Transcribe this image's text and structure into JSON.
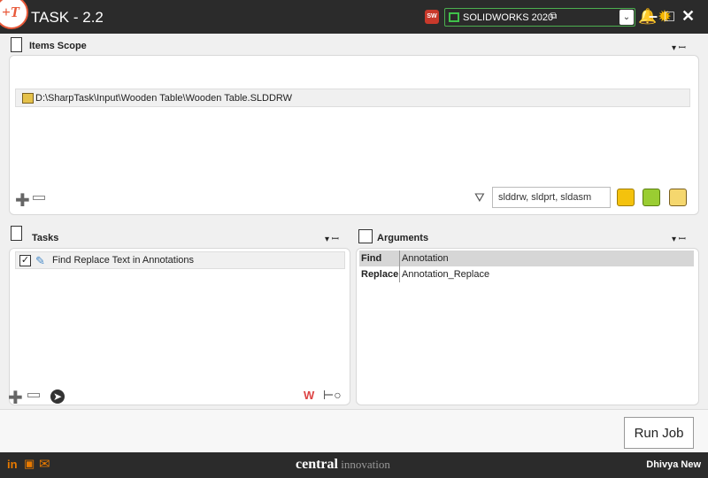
{
  "window": {
    "logo_text": "+T",
    "title": "TASK - 2.2",
    "solidworks_badge": "SW",
    "solidworks_version": "SOLIDWORKS 2020",
    "select_extra_glyph": "⧉",
    "dropdown_glyph": "⌄",
    "bell_glyph": "🔔",
    "gear_glyph": "✹",
    "minimize_glyph": "–",
    "maximize_glyph": "□",
    "close_glyph": "✕"
  },
  "items_scope": {
    "title": "Items Scope",
    "pin_glyph": "▾  ꟷ",
    "files": [
      "D:\\SharpTask\\Input\\Wooden Table\\Wooden Table.SLDDRW"
    ],
    "add_glyph": "✚",
    "filter_glyph": "⛛",
    "filter_value": "slddrw, sldprt, sldasm"
  },
  "tasks": {
    "title": "Tasks",
    "pin_glyph": "▾  ꟷ",
    "items": [
      {
        "label": "Find Replace Text in Annotations",
        "checked": "✓",
        "icon_glyph": "✎"
      }
    ],
    "globe_glyph": "➤",
    "w_glyph": "W",
    "key_glyph": "⊢○"
  },
  "arguments": {
    "title": "Arguments",
    "pin_glyph": "▾  ꟷ",
    "rows": [
      {
        "key": "Find",
        "value": "Annotation"
      },
      {
        "key": "Replace",
        "value": "Annotation_Replace"
      }
    ]
  },
  "actions": {
    "run_job_label": "Run Job"
  },
  "footer": {
    "linkedin": "in",
    "youtube_glyph": "▣",
    "mail_glyph": "✉",
    "brand_bold": "central",
    "brand_light": " innovation",
    "user": "Dhivya New"
  },
  "colors": {
    "titlebar": "#2b2b2b",
    "accent_orange": "#e87a00",
    "solidworks_green": "#3fc24a",
    "bell_gold": "#f6b700"
  }
}
